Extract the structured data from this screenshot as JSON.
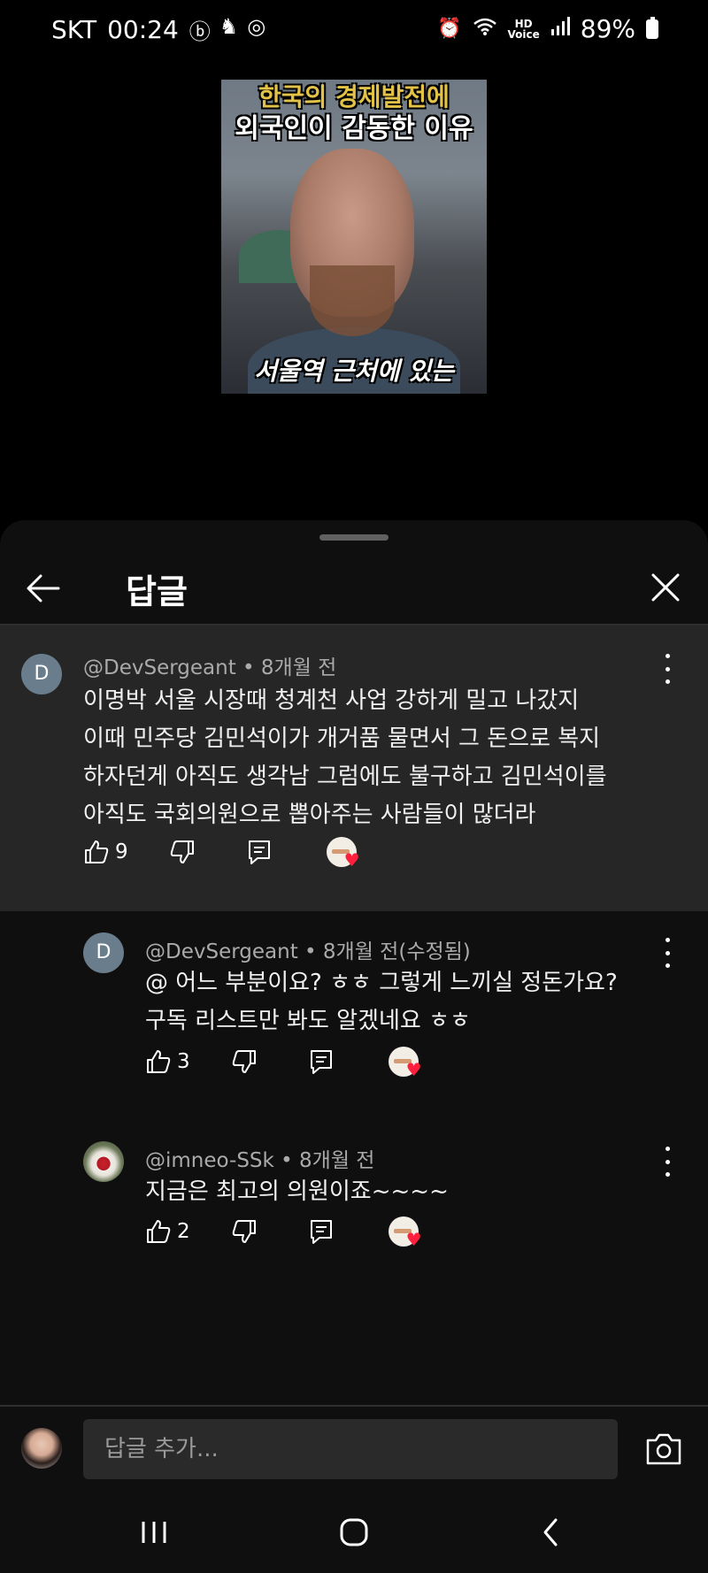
{
  "status_bar": {
    "carrier": "SKT",
    "time": "00:24",
    "battery": "89%",
    "left_icons": [
      "b-icon",
      "figure-icon",
      "fingerprint-icon"
    ],
    "right_icons": [
      "alarm-icon",
      "wifi-icon",
      "hd-voice-icon",
      "signal-icon",
      "battery-icon"
    ]
  },
  "video": {
    "title_line1": "한국의 경제발전에",
    "title_line2": "외국인이 감동한 이유",
    "subtitle": "서울역 근처에 있는"
  },
  "sheet": {
    "title": "답글",
    "back_icon": "arrow-left-icon",
    "close_icon": "close-icon"
  },
  "parent_comment": {
    "avatar_letter": "D",
    "author": "@DevSergeant",
    "time": "8개월 전",
    "text_lines": [
      "이명박 서울 시장때 청계천 사업 강하게 밀고 나갔지",
      "이때 민주당 김민석이가 개거품 물면서 그 돈으로 복지",
      "하자던게 아직도 생각남 그럼에도 불구하고 김민석이를",
      "아직도 국회의원으로 뽑아주는 사람들이 많더라"
    ],
    "likes": "9"
  },
  "replies": [
    {
      "avatar_letter": "D",
      "author": "@DevSergeant",
      "time": "8개월 전(수정됨)",
      "text_lines": [
        "@ 어느 부분이요? ㅎㅎ 그렇게 느끼실 정돈가요?",
        "구독 리스트만 봐도 알겠네요 ㅎㅎ"
      ],
      "likes": "3"
    },
    {
      "avatar_letter": "",
      "author": "@imneo-SSk",
      "time": "8개월 전",
      "text_lines": [
        "지금은  최고의 의원이죠~~~~"
      ],
      "likes": "2"
    }
  ],
  "input": {
    "placeholder": "답글 추가..."
  },
  "colors": {
    "sheet_bg": "#0f0f0f",
    "highlight_bg": "#262626",
    "heart": "#ff1f3d"
  }
}
